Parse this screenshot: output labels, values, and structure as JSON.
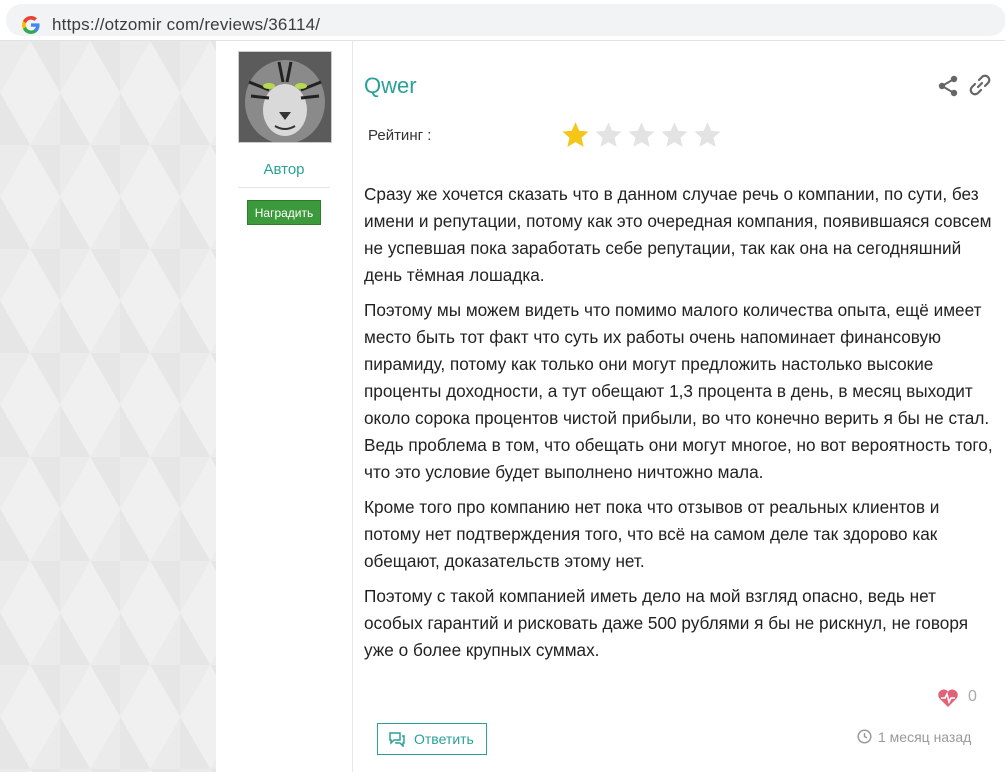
{
  "browser": {
    "url": "https://otzomir com/reviews/36114/",
    "logo_icon": "google-g-icon"
  },
  "author": {
    "role_label": "Автор",
    "reward_button": "Наградить",
    "avatar_icon": "tiger-avatar"
  },
  "review": {
    "username": "Qwer",
    "rating_label": "Рейтинг :",
    "rating": 1,
    "rating_max": 5,
    "paragraphs": [
      "Сразу же хочется сказать что в данном случае речь о компании, по сути, без имени и репутации, потому как это очередная компания, появившаяся совсем не успевшая пока заработать себе репутации, так как она на сегодняшний день тёмная лошадка.",
      "Поэтому мы можем видеть что помимо малого количества опыта, ещё имеет место быть тот факт что суть их работы очень напоминает финансовую пирамиду, потому как только они могут предложить настолько высокие проценты доходности, а тут обещают 1,3 процента в день, в месяц выходит около сорока процентов чистой прибыли, во что конечно верить я бы не стал. Ведь проблема в том, что обещать они могут многое, но вот вероятность того, что это условие будет выполнено ничтожно мала.",
      "Кроме того про компанию нет пока что отзывов от реальных клиентов и потому нет подтверждения того, что всё на самом деле так здорово как обещают, доказательств этому нет.",
      "Поэтому с такой компанией иметь дело на мой взгляд опасно, ведь нет особых гарантий и рисковать даже 500 рублями я бы не рискнул, не говоря уже о более крупных суммах."
    ],
    "likes": "0",
    "reply_button": "Ответить",
    "timestamp": "1 месяц назад"
  },
  "colors": {
    "accent": "#2aa198",
    "reward_green": "#3c9a3c",
    "star_filled": "#f5c518",
    "star_empty": "#e3e3e3",
    "heart": "#e06377"
  }
}
